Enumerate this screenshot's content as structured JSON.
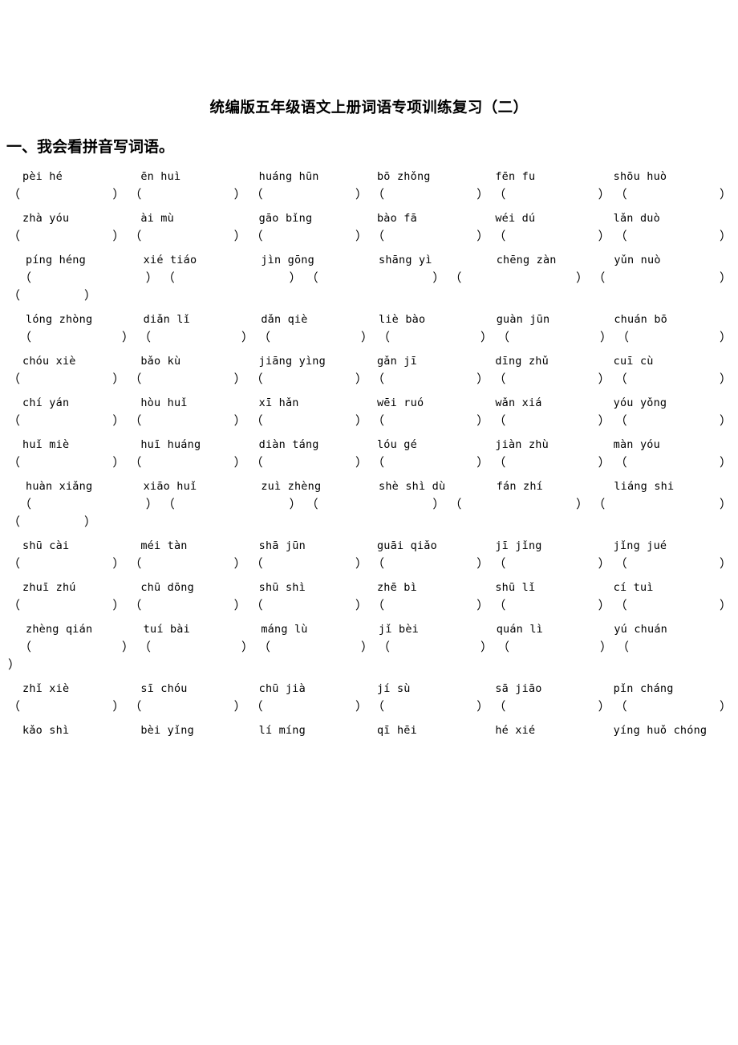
{
  "document": {
    "title": "统编版五年级语文上册词语专项训练复习（二）",
    "section_heading": "一、我会看拼音写词语。"
  },
  "exercise": {
    "bracket_open": "（",
    "bracket_close": "）",
    "rows": [
      {
        "id": "row-1",
        "words": [
          "pèi hé",
          "ēn huì",
          "huáng hūn",
          "bō zhǒng",
          "fēn fu",
          "shōu huò"
        ],
        "bracket_count": 6,
        "wrapped_brackets": 0,
        "indent": 0
      },
      {
        "id": "row-2",
        "words": [
          "zhà yóu",
          "ài mù",
          "gāo bǐng",
          "bào fā",
          "wéi dú",
          "lǎn duò"
        ],
        "bracket_count": 6,
        "wrapped_brackets": 0,
        "indent": 0
      },
      {
        "id": "row-3",
        "words": [
          "píng héng",
          "xié tiáo",
          "jìn gōng",
          "shāng yì",
          "chēng zàn",
          "yǔn nuò"
        ],
        "bracket_count": 6,
        "wrapped_brackets": 1,
        "indent": 1
      },
      {
        "id": "row-4",
        "words": [
          "lóng zhòng",
          "diǎn lǐ",
          "dǎn qiè",
          "liè bào",
          "guàn jūn",
          "chuán bō"
        ],
        "bracket_count": 6,
        "wrapped_brackets": 0,
        "indent": 1
      },
      {
        "id": "row-5",
        "words": [
          "chóu xiè",
          "bǎo kù",
          "jiāng yìng",
          "gǎn jī",
          "dīng zhǔ",
          "cuī cù"
        ],
        "bracket_count": 6,
        "wrapped_brackets": 0,
        "indent": 0
      },
      {
        "id": "row-6",
        "words": [
          "chí yán",
          "hòu huǐ",
          "xī hǎn",
          "wēi ruó",
          "wǎn xiá",
          "yóu yǒng"
        ],
        "bracket_count": 6,
        "wrapped_brackets": 0,
        "indent": 0
      },
      {
        "id": "row-7",
        "words": [
          "huǐ miè",
          "huī huáng",
          "diàn táng",
          "lóu gé",
          "jiàn zhù",
          "màn yóu"
        ],
        "bracket_count": 6,
        "wrapped_brackets": 0,
        "indent": 0
      },
      {
        "id": "row-8",
        "words": [
          "huàn xiǎng",
          "xiāo huǐ",
          "zuì zhèng",
          "shè shì dù",
          "fán zhí",
          "liáng shi"
        ],
        "bracket_count": 6,
        "wrapped_brackets": 1,
        "indent": 1
      },
      {
        "id": "row-9",
        "words": [
          "shū cài",
          "méi tàn",
          "shā jūn",
          "guāi qiǎo",
          "jī jǐng",
          "jǐng jué"
        ],
        "bracket_count": 6,
        "wrapped_brackets": 0,
        "indent": 0
      },
      {
        "id": "row-10",
        "words": [
          "zhuī zhú",
          "chū dōng",
          "shū shì",
          "zhē bì",
          "shū lǐ",
          "cí tuì"
        ],
        "bracket_count": 6,
        "wrapped_brackets": 0,
        "indent": 0
      },
      {
        "id": "row-11",
        "words": [
          "zhèng qián",
          "tuí bài",
          "máng lù",
          "jǐ bèi",
          "quán lì",
          "yú chuán"
        ],
        "bracket_count": 6,
        "wrapped_brackets": 0,
        "split_last_bracket": true,
        "indent": 1
      },
      {
        "id": "row-12",
        "words": [
          "zhǐ xiè",
          "sī chóu",
          "chū jià",
          "jí sù",
          "sā jiāo",
          "pǐn cháng"
        ],
        "bracket_count": 6,
        "wrapped_brackets": 0,
        "indent": 0
      },
      {
        "id": "row-13",
        "words": [
          "kǎo shì",
          "bèi yǐng",
          "lí míng",
          "qī hēi",
          "hé xié",
          "yíng huǒ chóng"
        ],
        "bracket_count": 0,
        "wrapped_brackets": 0,
        "indent": 0
      }
    ]
  }
}
